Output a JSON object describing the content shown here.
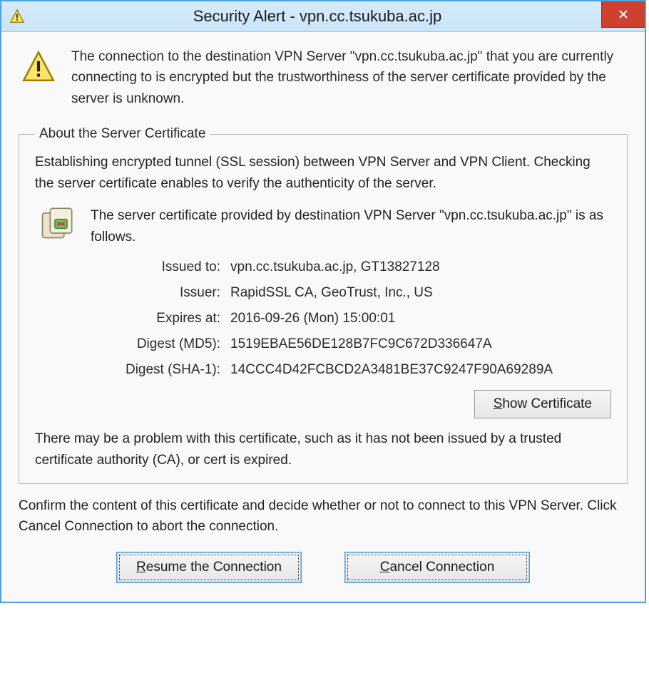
{
  "titlebar": {
    "title": "Security Alert - vpn.cc.tsukuba.ac.jp"
  },
  "intro": {
    "text": "The connection to the destination VPN Server \"vpn.cc.tsukuba.ac.jp\" that you are currently connecting to is encrypted but the trustworthiness of the server certificate provided by the server is unknown."
  },
  "group": {
    "legend": "About the Server Certificate",
    "intro": "Establishing encrypted tunnel (SSL session) between VPN Server and VPN Client. Checking the server certificate enables to verify the authenticity of the server.",
    "cert_intro": "The server certificate provided by destination VPN Server \"vpn.cc.tsukuba.ac.jp\" is as follows.",
    "fields": {
      "issued_to": {
        "label": "Issued to:",
        "value": "vpn.cc.tsukuba.ac.jp, GT13827128"
      },
      "issuer": {
        "label": "Issuer:",
        "value": "RapidSSL CA, GeoTrust, Inc., US"
      },
      "expires": {
        "label": "Expires at:",
        "value": "2016-09-26 (Mon) 15:00:01"
      },
      "md5": {
        "label": "Digest (MD5):",
        "value": "1519EBAE56DE128B7FC9C672D336647A"
      },
      "sha1": {
        "label": "Digest (SHA-1):",
        "value": "14CCC4D42FCBCD2A3481BE37C9247F90A69289A"
      }
    },
    "show_cert_label": "Show Certificate",
    "problem": "There may be a problem with this certificate, such as it has not been issued by a trusted certificate authority (CA), or cert is expired."
  },
  "confirm": {
    "text": "Confirm the content of this certificate and decide whether or not to connect to this VPN Server. Click Cancel Connection to abort the connection."
  },
  "buttons": {
    "resume": "Resume the Connection",
    "cancel": "Cancel Connection"
  }
}
